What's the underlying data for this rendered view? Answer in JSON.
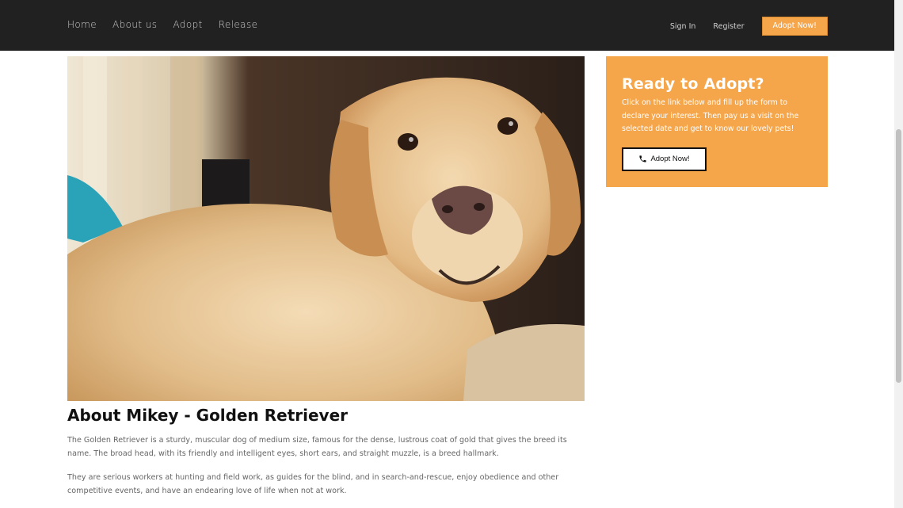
{
  "nav": {
    "links": [
      "Home",
      "About us",
      "Adopt",
      "Release"
    ],
    "sign_in": "Sign In",
    "register": "Register",
    "adopt_button": "Adopt Now!"
  },
  "main": {
    "image_icon": "golden-retriever-photo",
    "heading": "About Mikey - Golden Retriever",
    "paragraphs": [
      "The Golden Retriever is a sturdy, muscular dog of medium size, famous for the dense, lustrous coat of gold that gives the breed its name. The broad head, with its friendly and intelligent eyes, short ears, and straight muzzle, is a breed hallmark.",
      "They are serious workers at hunting and field work, as guides for the blind, and in search-and-rescue, enjoy obedience and other competitive events, and have an endearing love of life when not at work."
    ]
  },
  "sidebar": {
    "card_title": "Ready to Adopt?",
    "card_text": "Click on the link below and fill up the form to declare your interest. Then pay us a visit on the selected date and get to know our lovely pets!",
    "button_label": "Adopt Now!",
    "button_icon": "phone-icon"
  },
  "colors": {
    "nav_bg": "#212121",
    "accent": "#f5a54a",
    "heading": "#111111",
    "body_text": "#666666"
  }
}
